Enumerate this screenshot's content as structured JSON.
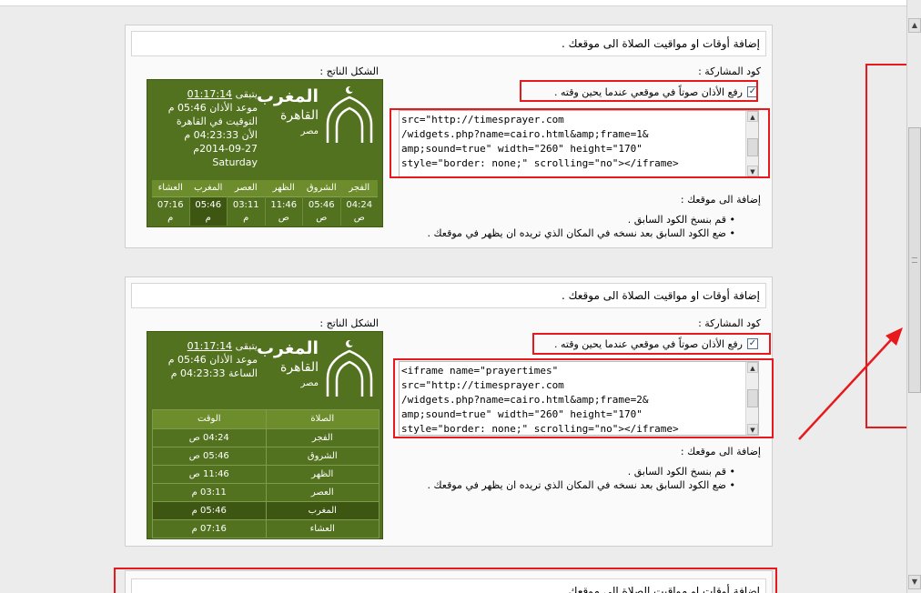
{
  "page": {
    "colors": {
      "widget_green": "#53721f",
      "widget_highlight": "#3d5713",
      "annotation_red": "#e8191c"
    }
  },
  "panel1": {
    "title": "إضافة أوقات او مواقيت الصلاة الى موقعك .",
    "share_label": "كود المشاركة :",
    "preview_label": "الشكل الناتج :",
    "adhan_checkbox_label": "رفع الأذان صوتاً في موقعي عندما يحين وقته .",
    "adhan_checked": true,
    "code": "src=\"http://timesprayer.com\n/widgets.php?name=cairo.html&amp;frame=1&\namp;sound=true\" width=\"260\" height=\"170\"\nstyle=\"border: none;\" scrolling=\"no\"></iframe>",
    "add_heading": "إضافة الى موقعك :",
    "steps": [
      "قم بنسخ الكود السابق .",
      "ضع الكود السابق بعد نسخه في المكان الذي تريده ان يظهر في موقعك ."
    ],
    "widget": {
      "prayer": "المغرب",
      "city": "القاهرة",
      "country": "مصر",
      "remaining_label": "يتبقى",
      "remaining_value": "01:17:14",
      "adhan_time_label": "موعد الأذان",
      "adhan_time_value": "05:46 م",
      "tz_label": "التوقيت في القاهرة",
      "now_label": "الأن",
      "now_value": "04:23:33 م",
      "date": "2014-09-27م",
      "day": "Saturday",
      "prayers": [
        {
          "name": "الفجر",
          "time": "04:24",
          "ampm": "ص"
        },
        {
          "name": "الشروق",
          "time": "05:46",
          "ampm": "ص"
        },
        {
          "name": "الظهر",
          "time": "11:46",
          "ampm": "ص"
        },
        {
          "name": "العصر",
          "time": "03:11",
          "ampm": "م"
        },
        {
          "name": "المغرب",
          "time": "05:46",
          "ampm": "م"
        },
        {
          "name": "العشاء",
          "time": "07:16",
          "ampm": "م"
        }
      ]
    }
  },
  "panel2": {
    "title": "إضافة أوقات او مواقيت الصلاة الى موقعك .",
    "share_label": "كود المشاركة :",
    "preview_label": "الشكل الناتج :",
    "adhan_checkbox_label": "رفع الأذان صوتاً في موقعي عندما يحين وقته .",
    "adhan_checked": true,
    "code": "<iframe name=\"prayertimes\"\nsrc=\"http://timesprayer.com\n/widgets.php?name=cairo.html&amp;frame=2&\namp;sound=true\" width=\"260\" height=\"170\"\nstyle=\"border: none;\" scrolling=\"no\"></iframe>",
    "add_heading": "إضافة الى موقعك :",
    "steps": [
      "قم بنسخ الكود السابق .",
      "ضع الكود السابق بعد نسخه في المكان الذي تريده ان يظهر في موقعك ."
    ],
    "widget": {
      "prayer": "المغرب",
      "city": "القاهرة",
      "country": "مصر",
      "remaining_label": "يتبقى",
      "remaining_value": "01:17:14",
      "adhan_time_label": "موعد الأذان",
      "adhan_time_value": "05:46 م",
      "clock_label": "الساعة",
      "clock_value": "04:23:33 م",
      "col_prayer": "الصلاة",
      "col_time": "الوقت",
      "rows": [
        {
          "name": "الفجر",
          "time": "04:24 ص"
        },
        {
          "name": "الشروق",
          "time": "05:46 ص"
        },
        {
          "name": "الظهر",
          "time": "11:46 ص"
        },
        {
          "name": "العصر",
          "time": "03:11 م"
        },
        {
          "name": "المغرب",
          "time": "05:46 م"
        },
        {
          "name": "العشاء",
          "time": "07:16 م"
        }
      ]
    }
  },
  "panel3": {
    "title": "إضافة أوقات او مواقيت الصلاة الى موقعك ."
  },
  "icons": {
    "mosque": "mosque-icon",
    "scroll_up": "arrow-up-icon",
    "scroll_down": "arrow-down-icon"
  }
}
